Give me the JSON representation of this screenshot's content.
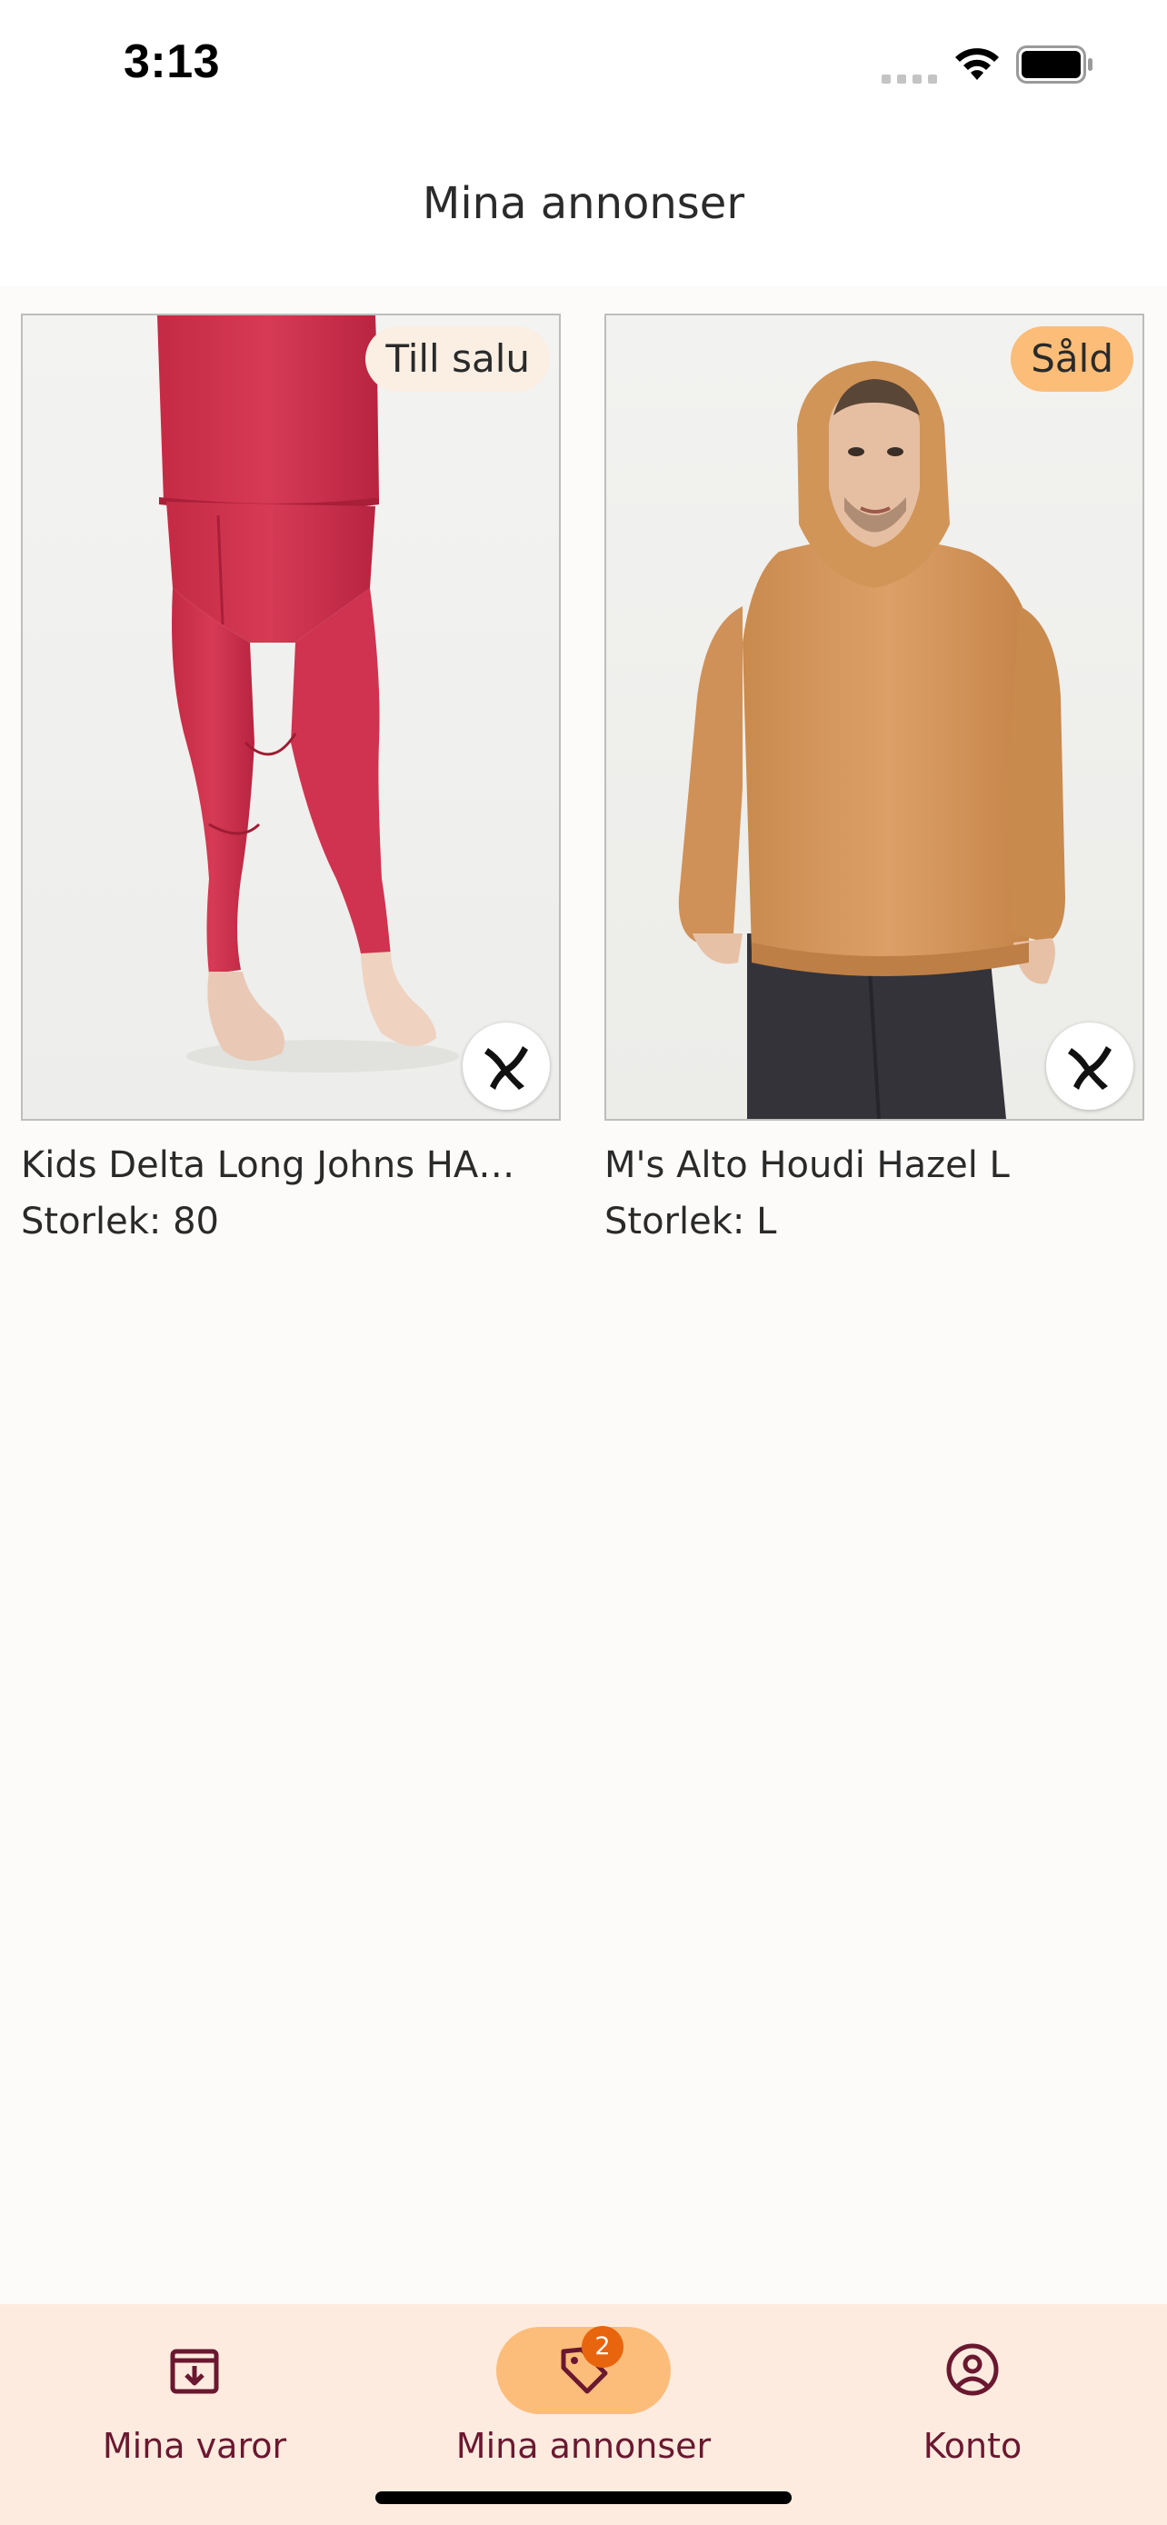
{
  "status_bar": {
    "time": "3:13",
    "icons": [
      "cellular-signal-icon",
      "wifi-icon",
      "battery-icon"
    ]
  },
  "header": {
    "title": "Mina annonser"
  },
  "listings": [
    {
      "status": "Till salu",
      "title": "Kids Delta Long Johns HAL ...",
      "size": "Storlek: 80",
      "brand_icon": "houdini-logo-icon",
      "photo": "red-long-johns-photo"
    },
    {
      "status": "Såld",
      "title": "M's Alto Houdi Hazel L",
      "size": "Storlek: L",
      "brand_icon": "houdini-logo-icon",
      "photo": "orange-hoodie-photo"
    }
  ],
  "tabs": [
    {
      "label": "Mina varor",
      "icon": "archive-box-icon",
      "active": false
    },
    {
      "label": "Mina annonser",
      "icon": "price-tag-icon",
      "active": true,
      "badge": "2"
    },
    {
      "label": "Konto",
      "icon": "user-circle-icon",
      "active": false
    }
  ],
  "colors": {
    "accent": "#fdbd7a",
    "tabbar_bg": "#fdebe0",
    "tab_label": "#6a1830",
    "badge": "#e8650e",
    "sale_badge": "#fbeee3",
    "sold_badge": "#fbbd78"
  }
}
